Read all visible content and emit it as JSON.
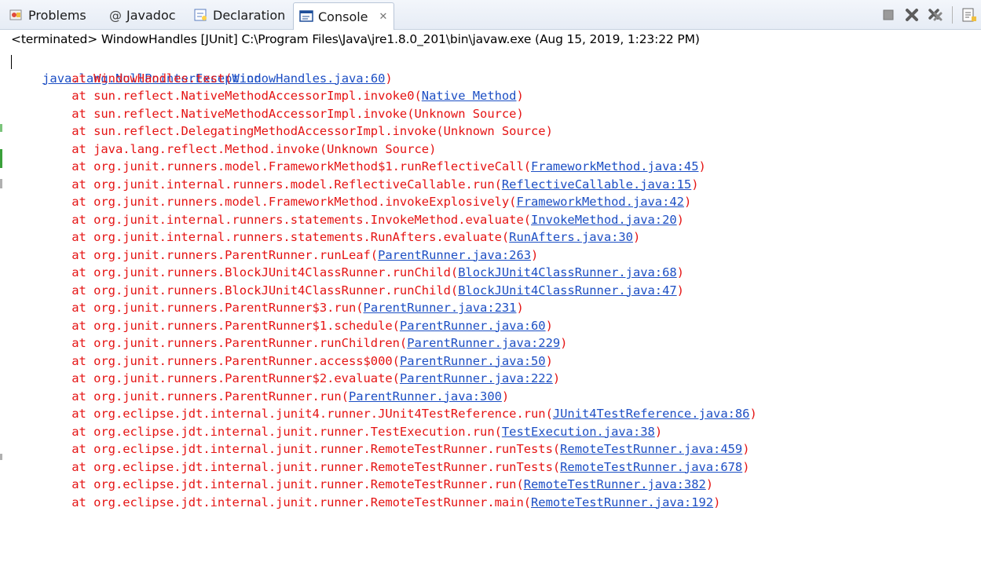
{
  "tabs": [
    {
      "label": "Problems",
      "icon": "problems-icon",
      "active": false
    },
    {
      "label": "Javadoc",
      "icon": "javadoc-icon",
      "active": false
    },
    {
      "label": "Declaration",
      "icon": "declaration-icon",
      "active": false
    },
    {
      "label": "Console",
      "icon": "console-icon",
      "active": true
    }
  ],
  "toolbar": [
    "stop-icon",
    "remove-launch-icon",
    "remove-all-icon",
    "clear-console-icon"
  ],
  "header": "<terminated> WindowHandles [JUnit] C:\\Program Files\\Java\\jre1.8.0_201\\bin\\javaw.exe (Aug 15, 2019, 1:23:22 PM)",
  "exception": "java.lang.NullPointerException",
  "stack": [
    {
      "at": "\tat WindowHandles.test(",
      "src": "WindowHandles.java:60"
    },
    {
      "at": "\tat sun.reflect.NativeMethodAccessorImpl.invoke0(",
      "src": "Native Method"
    },
    {
      "at": "\tat sun.reflect.NativeMethodAccessorImpl.invoke(Unknown Source)",
      "src": ""
    },
    {
      "at": "\tat sun.reflect.DelegatingMethodAccessorImpl.invoke(Unknown Source)",
      "src": ""
    },
    {
      "at": "\tat java.lang.reflect.Method.invoke(Unknown Source)",
      "src": ""
    },
    {
      "at": "\tat org.junit.runners.model.FrameworkMethod$1.runReflectiveCall(",
      "src": "FrameworkMethod.java:45"
    },
    {
      "at": "\tat org.junit.internal.runners.model.ReflectiveCallable.run(",
      "src": "ReflectiveCallable.java:15"
    },
    {
      "at": "\tat org.junit.runners.model.FrameworkMethod.invokeExplosively(",
      "src": "FrameworkMethod.java:42"
    },
    {
      "at": "\tat org.junit.internal.runners.statements.InvokeMethod.evaluate(",
      "src": "InvokeMethod.java:20"
    },
    {
      "at": "\tat org.junit.internal.runners.statements.RunAfters.evaluate(",
      "src": "RunAfters.java:30"
    },
    {
      "at": "\tat org.junit.runners.ParentRunner.runLeaf(",
      "src": "ParentRunner.java:263"
    },
    {
      "at": "\tat org.junit.runners.BlockJUnit4ClassRunner.runChild(",
      "src": "BlockJUnit4ClassRunner.java:68"
    },
    {
      "at": "\tat org.junit.runners.BlockJUnit4ClassRunner.runChild(",
      "src": "BlockJUnit4ClassRunner.java:47"
    },
    {
      "at": "\tat org.junit.runners.ParentRunner$3.run(",
      "src": "ParentRunner.java:231"
    },
    {
      "at": "\tat org.junit.runners.ParentRunner$1.schedule(",
      "src": "ParentRunner.java:60"
    },
    {
      "at": "\tat org.junit.runners.ParentRunner.runChildren(",
      "src": "ParentRunner.java:229"
    },
    {
      "at": "\tat org.junit.runners.ParentRunner.access$000(",
      "src": "ParentRunner.java:50"
    },
    {
      "at": "\tat org.junit.runners.ParentRunner$2.evaluate(",
      "src": "ParentRunner.java:222"
    },
    {
      "at": "\tat org.junit.runners.ParentRunner.run(",
      "src": "ParentRunner.java:300"
    },
    {
      "at": "\tat org.eclipse.jdt.internal.junit4.runner.JUnit4TestReference.run(",
      "src": "JUnit4TestReference.java:86"
    },
    {
      "at": "\tat org.eclipse.jdt.internal.junit.runner.TestExecution.run(",
      "src": "TestExecution.java:38"
    },
    {
      "at": "\tat org.eclipse.jdt.internal.junit.runner.RemoteTestRunner.runTests(",
      "src": "RemoteTestRunner.java:459"
    },
    {
      "at": "\tat org.eclipse.jdt.internal.junit.runner.RemoteTestRunner.runTests(",
      "src": "RemoteTestRunner.java:678"
    },
    {
      "at": "\tat org.eclipse.jdt.internal.junit.runner.RemoteTestRunner.run(",
      "src": "RemoteTestRunner.java:382"
    },
    {
      "at": "\tat org.eclipse.jdt.internal.junit.runner.RemoteTestRunner.main(",
      "src": "RemoteTestRunner.java:192"
    }
  ],
  "colors": {
    "error": "#e51414",
    "link": "#1d4fc4",
    "tabbar": "#e6ecf5"
  }
}
